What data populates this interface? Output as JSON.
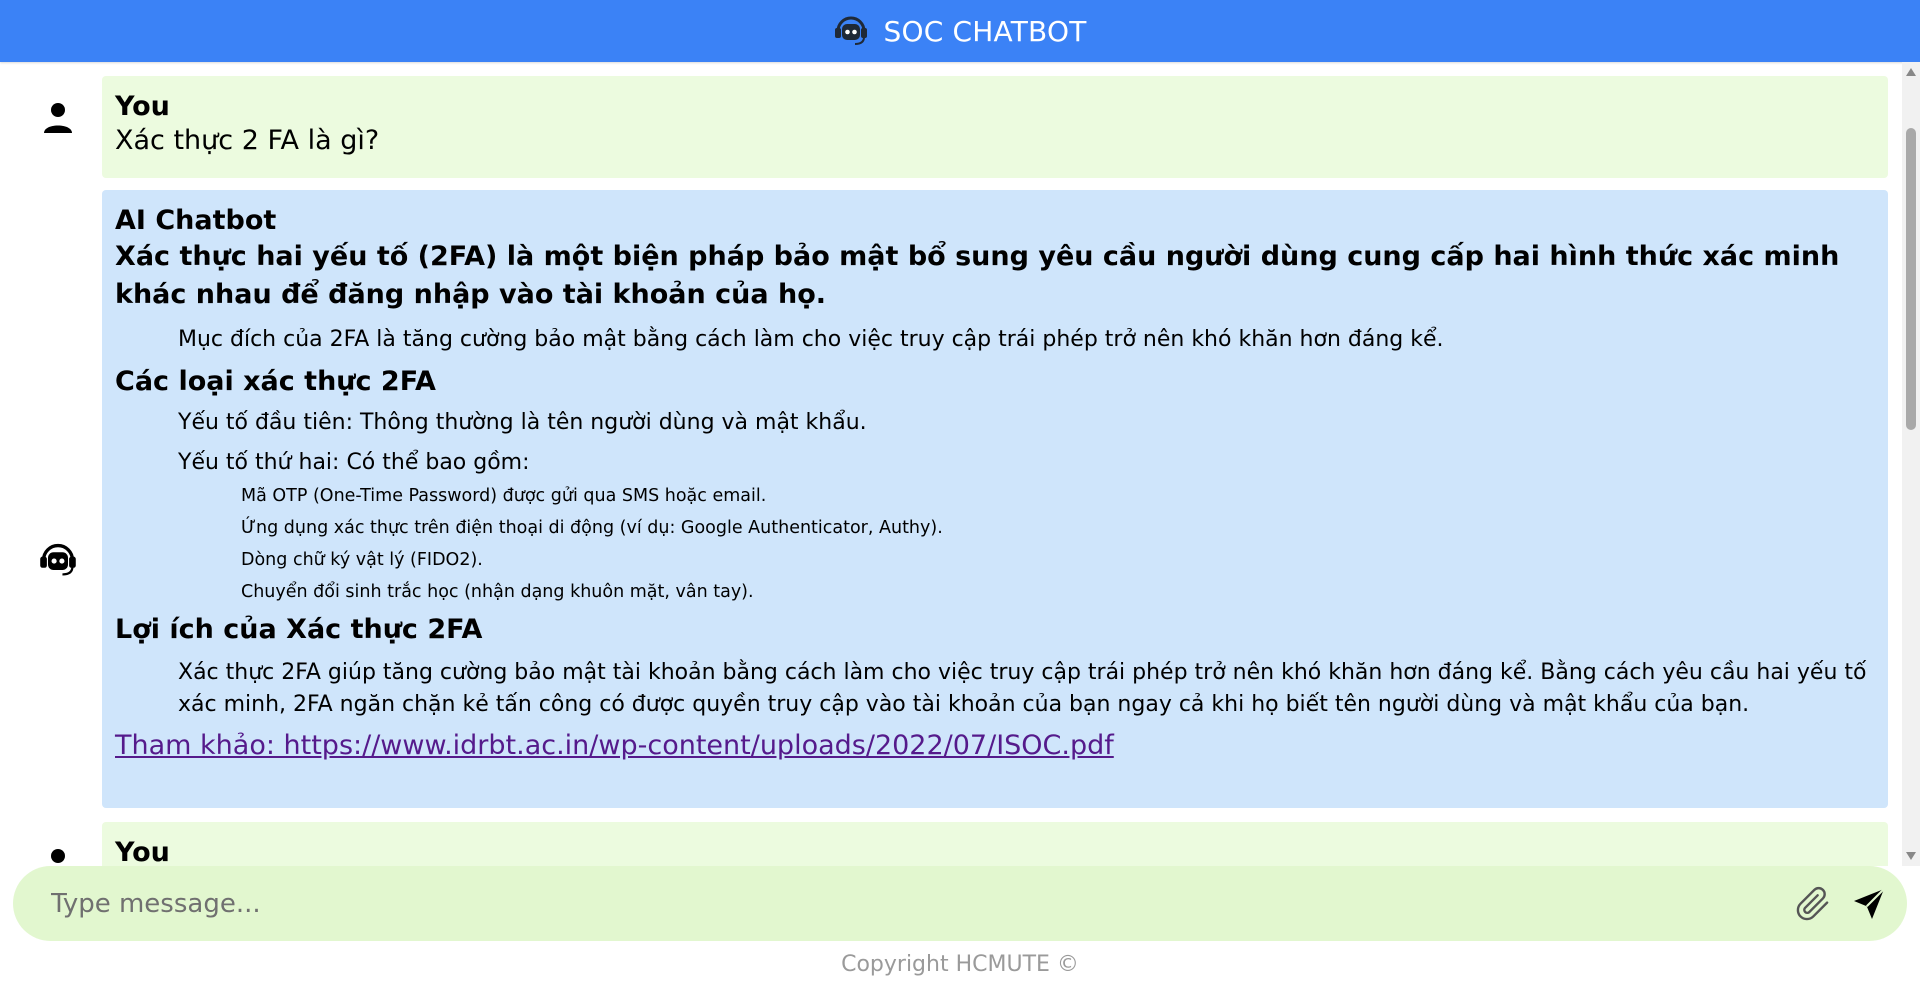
{
  "header": {
    "title": "SOC CHATBOT",
    "logo_icon": "robot-headset-icon",
    "background": "#3b82f6"
  },
  "messages": {
    "m1": {
      "sender": "You",
      "text": "Xác thực 2 FA là gì?",
      "avatar_icon": "person-icon",
      "background": "#ecfbdf"
    },
    "m2": {
      "sender": "AI Chatbot",
      "avatar_icon": "robot-headset-icon",
      "background": "#cfe5fb",
      "lead": "Xác thực hai yếu tố (2FA) là một biện pháp bảo mật bổ sung yêu cầu người dùng cung cấp hai hình thức xác minh khác nhau để đăng nhập vào tài khoản của họ.",
      "purpose": "Mục đích của 2FA là tăng cường bảo mật bằng cách làm cho việc truy cập trái phép trở nên khó khăn hơn đáng kể.",
      "types_heading": "Các loại xác thực 2FA",
      "factor1": "Yếu tố đầu tiên: Thông thường là tên người dùng và mật khẩu.",
      "factor2": "Yếu tố thứ hai: Có thể bao gồm:",
      "options": [
        "Mã OTP (One-Time Password) được gửi qua SMS hoặc email.",
        "Ứng dụng xác thực trên điện thoại di động (ví dụ: Google Authenticator, Authy).",
        "Dòng chữ ký vật lý (FIDO2).",
        "Chuyển đổi sinh trắc học (nhận dạng khuôn mặt, vân tay)."
      ],
      "benefits_heading": "Lợi ích của Xác thực 2FA",
      "benefits_text": "Xác thực 2FA giúp tăng cường bảo mật tài khoản bằng cách làm cho việc truy cập trái phép trở nên khó khăn hơn đáng kể. Bằng cách yêu cầu hai yếu tố xác minh, 2FA ngăn chặn kẻ tấn công có được quyền truy cập vào tài khoản của bạn ngay cả khi họ biết tên người dùng và mật khẩu của bạn.",
      "reference": "Tham khảo: https://www.idrbt.ac.in/wp-content/uploads/2022/07/ISOC.pdf"
    },
    "m3": {
      "sender": "You",
      "avatar_icon": "person-icon"
    }
  },
  "composer": {
    "placeholder": "Type message...",
    "attach_icon": "paperclip-icon",
    "send_icon": "send-icon",
    "background": "#e2f7cf"
  },
  "footer": {
    "copyright": "Copyright HCMUTE ©"
  }
}
